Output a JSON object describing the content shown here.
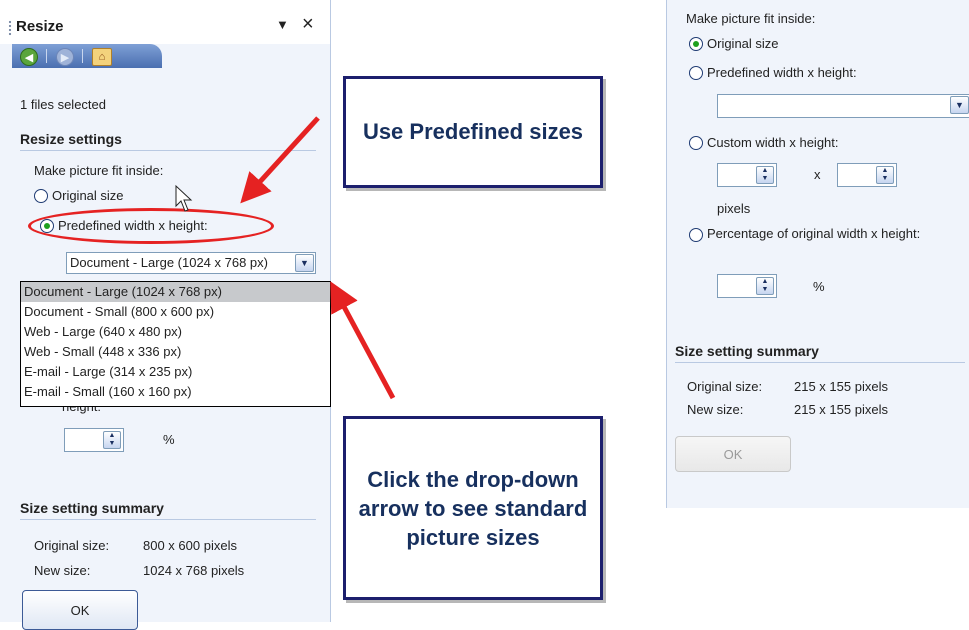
{
  "left_pane": {
    "title": "Resize",
    "menu_glyph": "▼",
    "close_glyph": "×",
    "nav": {
      "back_icon": "back-arrow-icon",
      "forward_icon": "forward-arrow-icon",
      "home_icon": "home-icon"
    },
    "files_selected": "1 files selected",
    "resize_settings_heading": "Resize settings",
    "fit_label": "Make picture fit inside:",
    "radio_original": "Original size",
    "radio_predefined": "Predefined width x height:",
    "predefined_selected": "Document - Large (1024 x 768 px)",
    "dropdown_options": [
      "Document - Large (1024 x 768 px)",
      "Document - Small (800 x 600 px)",
      "Web - Large (640 x 480 px)",
      "Web - Small (448 x 336 px)",
      "E-mail - Large (314 x 235 px)",
      "E-mail - Small (160 x 160 px)"
    ],
    "height_label": "height:",
    "percent_symbol": "%",
    "summary_heading": "Size setting summary",
    "original_size_label": "Original size:",
    "original_size_value": "800 x 600 pixels",
    "new_size_label": "New size:",
    "new_size_value": "1024 x 768 pixels",
    "ok_label": "OK"
  },
  "callouts": {
    "top": "Use Predefined sizes",
    "bottom": "Click the drop-down arrow to see standard picture sizes"
  },
  "right_pane": {
    "fit_label": "Make picture fit inside:",
    "radio_original": "Original size",
    "radio_predefined": "Predefined width x height:",
    "radio_custom": "Custom width x height:",
    "times_symbol": "x",
    "pixels_label": "pixels",
    "radio_percent": "Percentage of original width x height:",
    "percent_symbol": "%",
    "summary_heading": "Size setting summary",
    "original_size_label": "Original size:",
    "original_size_value": "215 x 155 pixels",
    "new_size_label": "New size:",
    "new_size_value": "215 x 155 pixels",
    "ok_label": "OK"
  },
  "colors": {
    "pane_background": "#f0f4fb",
    "annotation_red": "#e52222",
    "callout_border": "#1c1f6d",
    "callout_text": "#17305e",
    "selected_radio": "#1ea01e"
  }
}
